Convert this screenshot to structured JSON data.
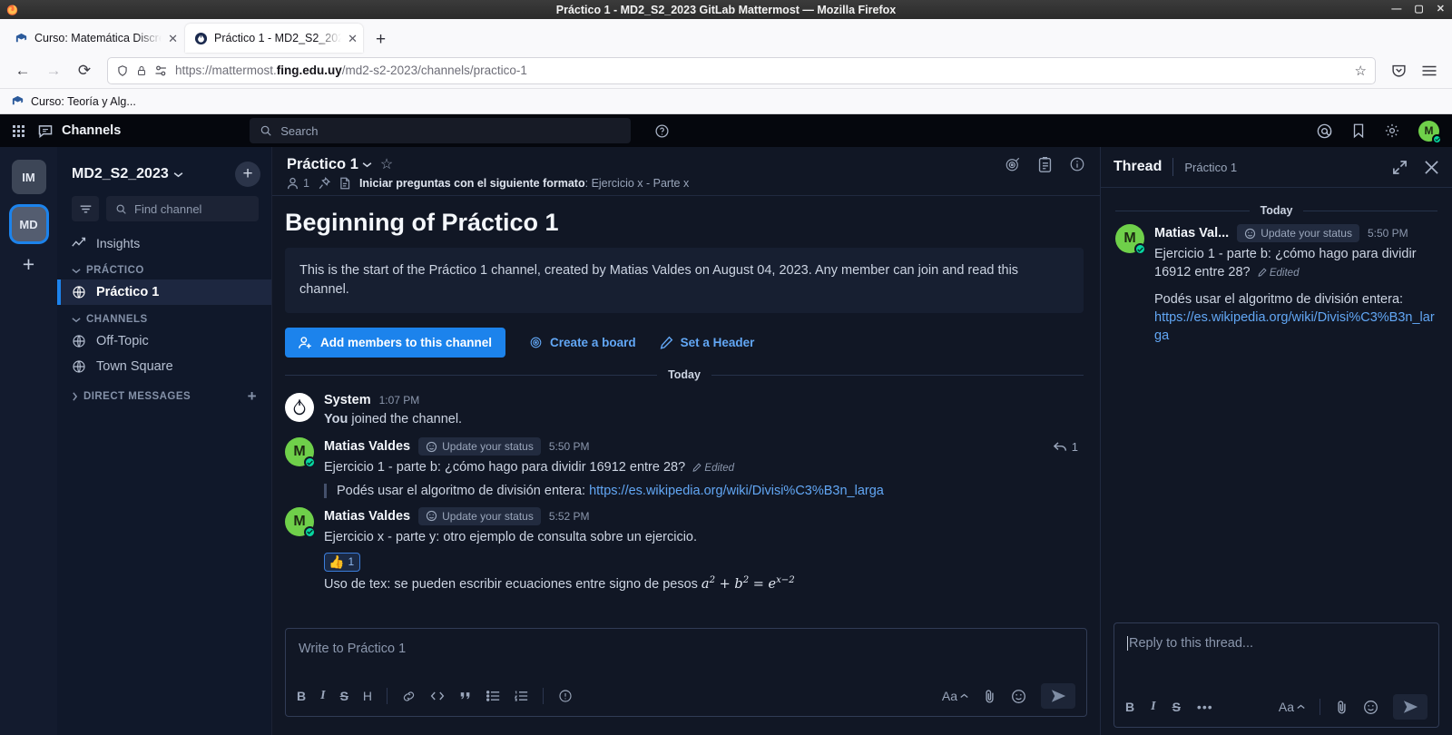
{
  "window": {
    "title": "Práctico 1 - MD2_S2_2023 GitLab Mattermost — Mozilla Firefox",
    "minimize": "—",
    "maximize": "▢",
    "close": "✕"
  },
  "browser": {
    "tabs": [
      {
        "title": "Curso: Matemática Discre",
        "favicon": "moodle-icon",
        "close": "✕",
        "active": false
      },
      {
        "title": "Práctico 1 - MD2_S2_202",
        "favicon": "mattermost-icon",
        "close": "✕",
        "active": true
      }
    ],
    "new_tab_label": "+",
    "nav": {
      "back": "←",
      "forward": "→",
      "reload": "⟳"
    },
    "url": {
      "scheme": "https://mattermost.",
      "domain": "fing.edu.uy",
      "path": "/md2-s2-2023/channels/practico-1"
    },
    "bookmarks": [
      {
        "label": "Curso: Teoría y Alg...",
        "icon": "moodle-icon"
      }
    ]
  },
  "mattermost": {
    "global": {
      "product_label": "Channels",
      "search_placeholder": "Search",
      "icons": [
        "grid-icon",
        "help-icon",
        "mentions-icon",
        "saved-posts-icon",
        "settings-icon"
      ],
      "avatar_initial": "M"
    },
    "teams": [
      {
        "initials": "IM",
        "selected": false
      },
      {
        "initials": "MD",
        "selected": true
      }
    ],
    "team_add_label": "+",
    "sidebar": {
      "team_name": "MD2_S2_2023",
      "browse_label": "+",
      "find_placeholder": "Find channel",
      "insights_label": "Insights",
      "categories": [
        {
          "label": "PRÁCTICO",
          "expanded": true,
          "add": "",
          "channels": [
            {
              "name": "Práctico 1",
              "icon": "globe-icon",
              "active": true
            }
          ]
        },
        {
          "label": "CHANNELS",
          "expanded": true,
          "add": "",
          "channels": [
            {
              "name": "Off-Topic",
              "icon": "globe-icon",
              "active": false
            },
            {
              "name": "Town Square",
              "icon": "globe-icon",
              "active": false
            }
          ]
        },
        {
          "label": "DIRECT MESSAGES",
          "expanded": false,
          "add": "+",
          "channels": []
        }
      ]
    },
    "channel": {
      "title": "Práctico 1",
      "member_count": "1",
      "header_prefix": "Iniciar preguntas con el siguiente formato",
      "header_rest": ": Ejercicio x - Parte x",
      "intro_title": "Beginning of Práctico 1",
      "intro_text": "This is the start of the Práctico 1 channel, created by Matias Valdes on August 04, 2023. Any member can join and read this channel.",
      "actions": {
        "add_members": "Add members to this channel",
        "create_board": "Create a board",
        "set_header": "Set a Header"
      },
      "day_divider": "Today",
      "posts": [
        {
          "author": "System",
          "time": "1:07 PM",
          "avatar": "system",
          "text_prefix": "You",
          "text_rest": " joined the channel."
        },
        {
          "author": "Matias Valdes",
          "status_chip": "Update your status",
          "time": "5:50 PM",
          "avatar": "M",
          "text": "Ejercicio 1 - parte b: ¿cómo hago para dividir 16912 entre 28?",
          "edited": "Edited",
          "quote_text": "Podés usar el algoritmo de división entera: ",
          "quote_link": "https://es.wikipedia.org/wiki/Divisi%C3%B3n_larga",
          "reply_count": "1"
        },
        {
          "author": "Matias Valdes",
          "status_chip": "Update your status",
          "time": "5:52 PM",
          "avatar": "M",
          "text": "Ejercicio x - parte y: otro ejemplo de consulta sobre un ejercicio.",
          "reaction": {
            "emoji": "👍",
            "count": "1"
          },
          "text2_prefix": "Uso de tex: se pueden escribir ecuaciones entre signo de pesos ",
          "equation": "a² + b² = e^(x−2)"
        }
      ],
      "composer": {
        "placeholder": "Write to Práctico 1",
        "tools": [
          "B",
          "I",
          "S",
          "H",
          "link-icon",
          "code-icon",
          "quote-icon",
          "bullet-list-icon",
          "numbered-list-icon",
          "help-icon"
        ],
        "format_label": "Aa",
        "right_tools": [
          "attach-icon",
          "emoji-icon",
          "send-icon"
        ]
      }
    },
    "thread": {
      "title": "Thread",
      "channel_name": "Práctico 1",
      "expand_label": "expand-icon",
      "close_label": "✕",
      "day_divider": "Today",
      "root_post": {
        "author": "Matias Val...",
        "status_chip": "Update your status",
        "time": "5:50 PM",
        "avatar": "M",
        "text": "Ejercicio 1 - parte b: ¿cómo hago para dividir 16912 entre 28?",
        "edited": "Edited",
        "body_text": "Podés usar el algoritmo de división entera:",
        "body_link": "https://es.wikipedia.org/wiki/Divisi%C3%B3n_larga"
      },
      "reply_placeholder": "Reply to this thread...",
      "tools": [
        "B",
        "I",
        "S",
        "more-icon"
      ],
      "format_label": "Aa",
      "right_tools": [
        "attach-icon",
        "emoji-icon",
        "send-icon"
      ]
    }
  },
  "colors": {
    "accent_blue": "#1c83ec",
    "link_blue": "#62a7f5",
    "sidebar_bg": "#10182a",
    "center_bg": "#111725",
    "online_green": "#06d6a0",
    "avatar_green": "#6fd04a"
  }
}
